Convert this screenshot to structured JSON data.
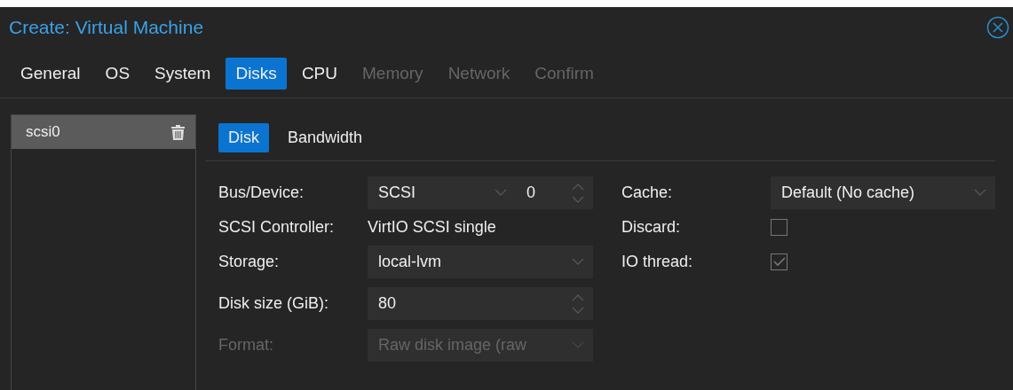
{
  "window": {
    "title": "Create: Virtual Machine"
  },
  "wizard_tabs": [
    {
      "label": "General",
      "selected": false,
      "disabled": false
    },
    {
      "label": "OS",
      "selected": false,
      "disabled": false
    },
    {
      "label": "System",
      "selected": false,
      "disabled": false
    },
    {
      "label": "Disks",
      "selected": true,
      "disabled": false
    },
    {
      "label": "CPU",
      "selected": false,
      "disabled": false
    },
    {
      "label": "Memory",
      "selected": false,
      "disabled": true
    },
    {
      "label": "Network",
      "selected": false,
      "disabled": true
    },
    {
      "label": "Confirm",
      "selected": false,
      "disabled": true
    }
  ],
  "disks": [
    {
      "label": "scsi0",
      "selected": true
    }
  ],
  "disk_tabs": [
    {
      "label": "Disk",
      "selected": true
    },
    {
      "label": "Bandwidth",
      "selected": false
    }
  ],
  "left_fields": [
    {
      "kind": "select_spinner",
      "label": "Bus/Device:",
      "value": "SCSI",
      "number": "0",
      "disabled": false
    },
    {
      "kind": "text",
      "label": "SCSI Controller:",
      "value": "VirtIO SCSI single",
      "disabled": false
    },
    {
      "kind": "select",
      "label": "Storage:",
      "value": "local-lvm",
      "disabled": false
    },
    {
      "kind": "spinner",
      "label": "Disk size (GiB):",
      "value": "80",
      "disabled": false
    },
    {
      "kind": "select",
      "label": "Format:",
      "value": "Raw disk image (raw",
      "disabled": true
    }
  ],
  "right_fields": [
    {
      "kind": "select",
      "label": "Cache:",
      "value": "Default (No cache)"
    },
    {
      "kind": "checkbox",
      "label": "Discard:",
      "checked": false
    },
    {
      "kind": "checkbox",
      "label": "IO thread:",
      "checked": true
    }
  ]
}
